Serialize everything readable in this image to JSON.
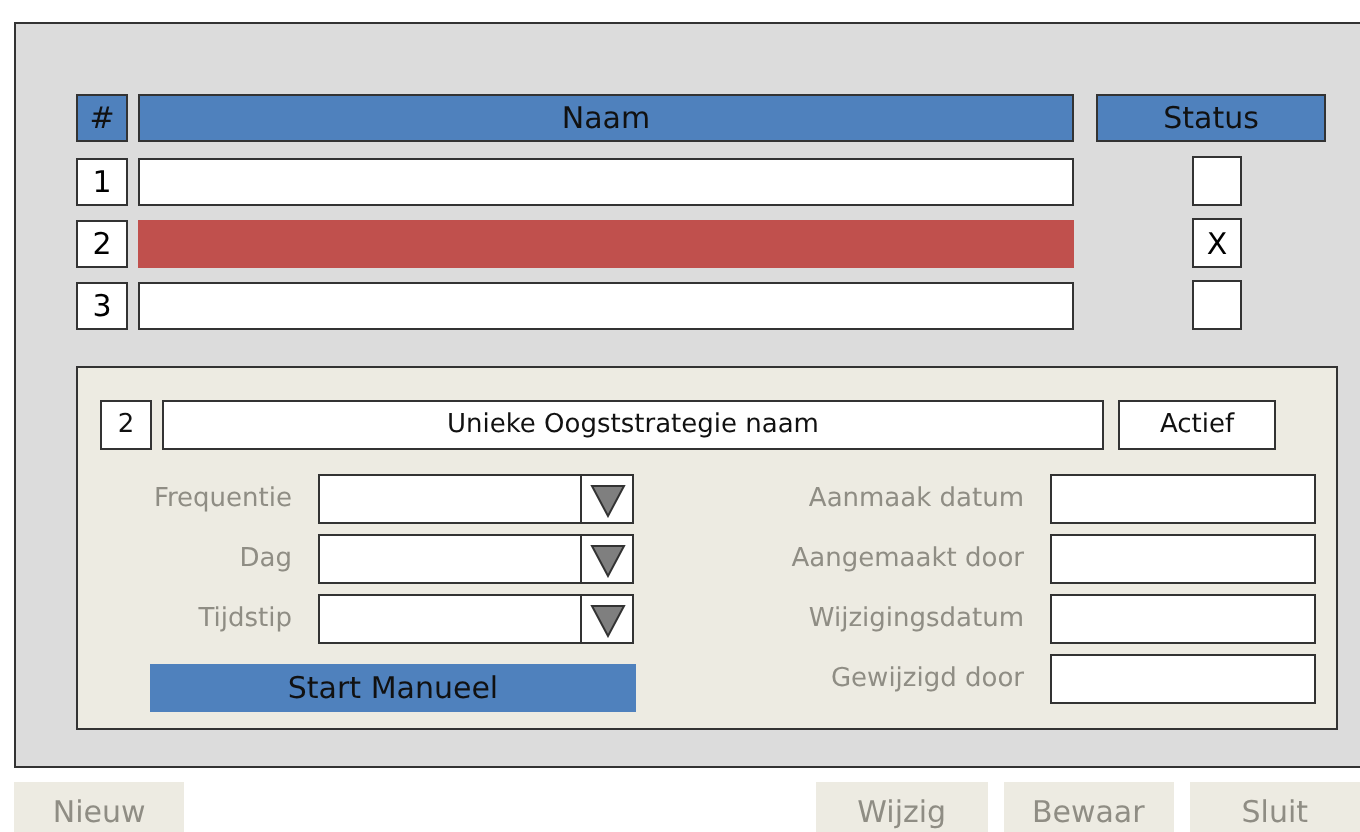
{
  "table": {
    "columns": [
      "#",
      "Naam",
      "Status"
    ],
    "check_mark": "X",
    "rows": [
      {
        "number": "1",
        "selected": false,
        "checked": false
      },
      {
        "number": "2",
        "selected": true,
        "checked": true
      },
      {
        "number": "3",
        "selected": false,
        "checked": false
      }
    ]
  },
  "detail": {
    "number": "2",
    "name": "Unieke Oogststrategie naam",
    "status": "Actief",
    "dropdowns": [
      {
        "label": "Frequentie"
      },
      {
        "label": "Dag"
      },
      {
        "label": "Tijdstip"
      }
    ],
    "start_button": "Start Manueel",
    "fields": [
      {
        "label": "Aanmaak datum"
      },
      {
        "label": "Aangemaakt door"
      },
      {
        "label": "Wijzigingsdatum"
      },
      {
        "label": "Gewijzigd door"
      }
    ]
  },
  "buttons": [
    {
      "label": "Nieuw",
      "kind": "left"
    },
    {
      "label": "Wijzig",
      "kind": "right"
    },
    {
      "label": "Bewaar",
      "kind": "right"
    },
    {
      "label": "Sluit",
      "kind": "right"
    }
  ]
}
